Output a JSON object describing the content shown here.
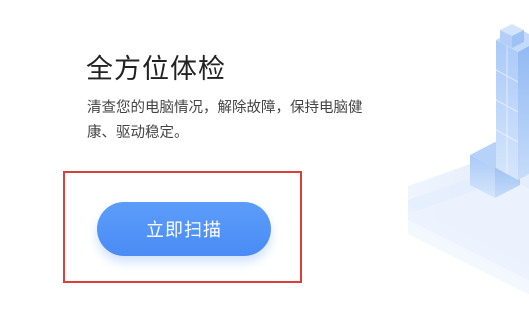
{
  "main": {
    "title": "全方位体检",
    "description": "清查您的电脑情况，解除故障，保持电脑健康、驱动稳定。",
    "scan_button_label": "立即扫描"
  },
  "colors": {
    "accent": "#4A8BF5",
    "highlight_border": "#D9403C",
    "title_text": "#222222",
    "body_text": "#444444"
  },
  "illustration": {
    "icon": "isometric-blocks-illustration"
  }
}
